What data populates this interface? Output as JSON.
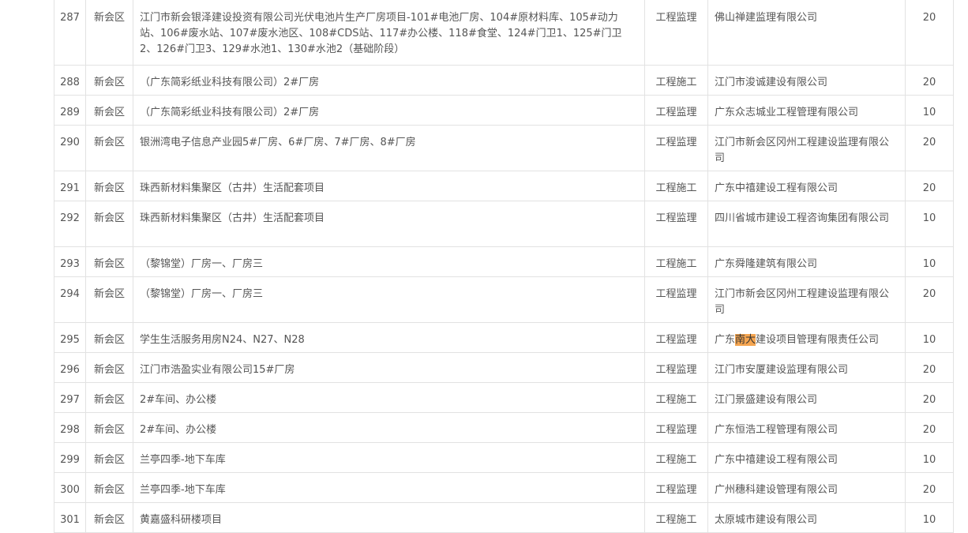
{
  "table": {
    "rows": [
      {
        "no": "287",
        "district": "新会区",
        "project": "江门市新会银泽建设投资有限公司光伏电池片生产厂房项目-101#电池厂房、104#原材料库、105#动力站、106#废水站、107#废水池区、108#CDS站、117#办公楼、118#食堂、124#门卫1、125#门卫2、126#门卫3、129#水池1、130#水池2（基础阶段）",
        "type": "工程监理",
        "company": "佛山禅建监理有限公司",
        "score": "20"
      },
      {
        "no": "288",
        "district": "新会区",
        "project": "（广东简彩纸业科技有限公司）2#厂房",
        "type": "工程施工",
        "company": "江门市浚诚建设有限公司",
        "score": "20"
      },
      {
        "no": "289",
        "district": "新会区",
        "project": "（广东简彩纸业科技有限公司）2#厂房",
        "type": "工程监理",
        "company": "广东众志城业工程管理有限公司",
        "score": "10"
      },
      {
        "no": "290",
        "district": "新会区",
        "project": "银洲湾电子信息产业园5#厂房、6#厂房、7#厂房、8#厂房",
        "type": "工程监理",
        "company": "江门市新会区冈州工程建设监理有限公司",
        "score": "20"
      },
      {
        "no": "291",
        "district": "新会区",
        "project": "珠西新材料集聚区（古井）生活配套项目",
        "type": "工程施工",
        "company": "广东中禧建设工程有限公司",
        "score": "20"
      },
      {
        "no": "292",
        "district": "新会区",
        "project": "珠西新材料集聚区（古井）生活配套项目",
        "type": "工程监理",
        "company": "四川省城市建设工程咨询集团有限公司",
        "score": "10"
      },
      {
        "no": "293",
        "district": "新会区",
        "project": "（黎锦堂）厂房一、厂房三",
        "type": "工程施工",
        "company": "广东舜隆建筑有限公司",
        "score": "10"
      },
      {
        "no": "294",
        "district": "新会区",
        "project": "（黎锦堂）厂房一、厂房三",
        "type": "工程监理",
        "company": "江门市新会区冈州工程建设监理有限公司",
        "score": "20"
      },
      {
        "no": "295",
        "district": "新会区",
        "project": "学生生活服务用房N24、N27、N28",
        "type": "工程监理",
        "company_pre": "广东",
        "company_hl": "南大",
        "company_post": "建设项目管理有限责任公司",
        "score": "10"
      },
      {
        "no": "296",
        "district": "新会区",
        "project": "江门市浩盈实业有限公司15#厂房",
        "type": "工程监理",
        "company": "江门市安厦建设监理有限公司",
        "score": "20"
      },
      {
        "no": "297",
        "district": "新会区",
        "project": "2#车间、办公楼",
        "type": "工程施工",
        "company": "江门景盛建设有限公司",
        "score": "20"
      },
      {
        "no": "298",
        "district": "新会区",
        "project": "2#车间、办公楼",
        "type": "工程监理",
        "company": "广东恒浩工程管理有限公司",
        "score": "20"
      },
      {
        "no": "299",
        "district": "新会区",
        "project": "兰亭四季-地下车库",
        "type": "工程施工",
        "company": "广东中禧建设工程有限公司",
        "score": "10"
      },
      {
        "no": "300",
        "district": "新会区",
        "project": "兰亭四季-地下车库",
        "type": "工程监理",
        "company": "广州穗科建设管理有限公司",
        "score": "20"
      },
      {
        "no": "301",
        "district": "新会区",
        "project": "黄嘉盛科研楼项目",
        "type": "工程施工",
        "company": "太原城市建设有限公司",
        "score": "10"
      }
    ],
    "highlight_color": "#f5a550",
    "border_color": "#e2e2e2",
    "text_color": "#555555"
  }
}
